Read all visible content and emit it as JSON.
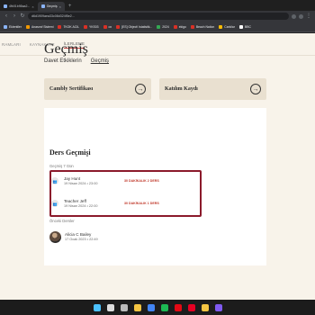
{
  "browser": {
    "tabs": [
      {
        "label": "4fb01b98aa2...",
        "active": false
      },
      {
        "label": "Geçmiş",
        "active": true
      }
    ],
    "address": "d6d1909aea33c08d324f5e2...",
    "bookmarks": [
      {
        "label": "Eklentiler",
        "color": "#8ab4f8"
      },
      {
        "label": "Anasınıf Sistemi",
        "color": "#f29900"
      },
      {
        "label": "TKOK ACIL",
        "color": "#d93025"
      },
      {
        "label": "YKS03",
        "color": "#d93025"
      },
      {
        "label": "ox",
        "color": "#d93025"
      },
      {
        "label": "[ES] Object! Istatistik...",
        "color": "#d93025"
      },
      {
        "label": "2024",
        "color": "#34a853"
      },
      {
        "label": "ekigo",
        "color": "#d93025"
      },
      {
        "label": "Beach Nation",
        "color": "#d93025"
      },
      {
        "label": "Canlılar",
        "color": "#fbbc04"
      },
      {
        "label": "BBC",
        "color": "#ffffff"
      }
    ]
  },
  "nav": {
    "items": [
      "RAMLARI",
      "KAYNAKLAR",
      "İLERLEME"
    ],
    "active_index": 2
  },
  "page": {
    "title": "Geçmiş",
    "subtabs": [
      "Davet Etkiklerin",
      "Geçmiş"
    ],
    "active_subtab": 1
  },
  "cards": [
    {
      "label": "Cambly Sertifikası",
      "arrow": "→"
    },
    {
      "label": "Katılım Kaydı",
      "arrow": "→"
    }
  ],
  "history": {
    "title": "Ders Geçmişi",
    "section_recent": "Geçmiş 7 Gün",
    "recent": [
      {
        "name": "Jay Hunt",
        "date": "19 Nisan 2024 • 23:00",
        "duration": "30 DAKİKALIK 2 DERS"
      },
      {
        "name": "Teacher Jeff",
        "date": "19 Nisan 2024 • 22:00",
        "duration": "30 DAKİKALIK 1 DERS"
      }
    ],
    "section_older": "Önceki Dersler",
    "older": [
      {
        "name": "Alicia C Bailey",
        "date": "17 Ocak 2023 • 22:49"
      }
    ]
  },
  "taskbar": {
    "icons": [
      "windows-icon",
      "search-icon",
      "taskview-icon",
      "explorer-icon",
      "chrome-icon",
      "spotify-icon",
      "netflix-icon",
      "pinterest-icon",
      "folder-icon",
      "store-icon"
    ],
    "colors": [
      "#4cc2ff",
      "#dddddd",
      "#bbbbbb",
      "#f5c542",
      "#4285f4",
      "#1db954",
      "#e50914",
      "#e60023",
      "#f5c542",
      "#7f5af0"
    ]
  }
}
